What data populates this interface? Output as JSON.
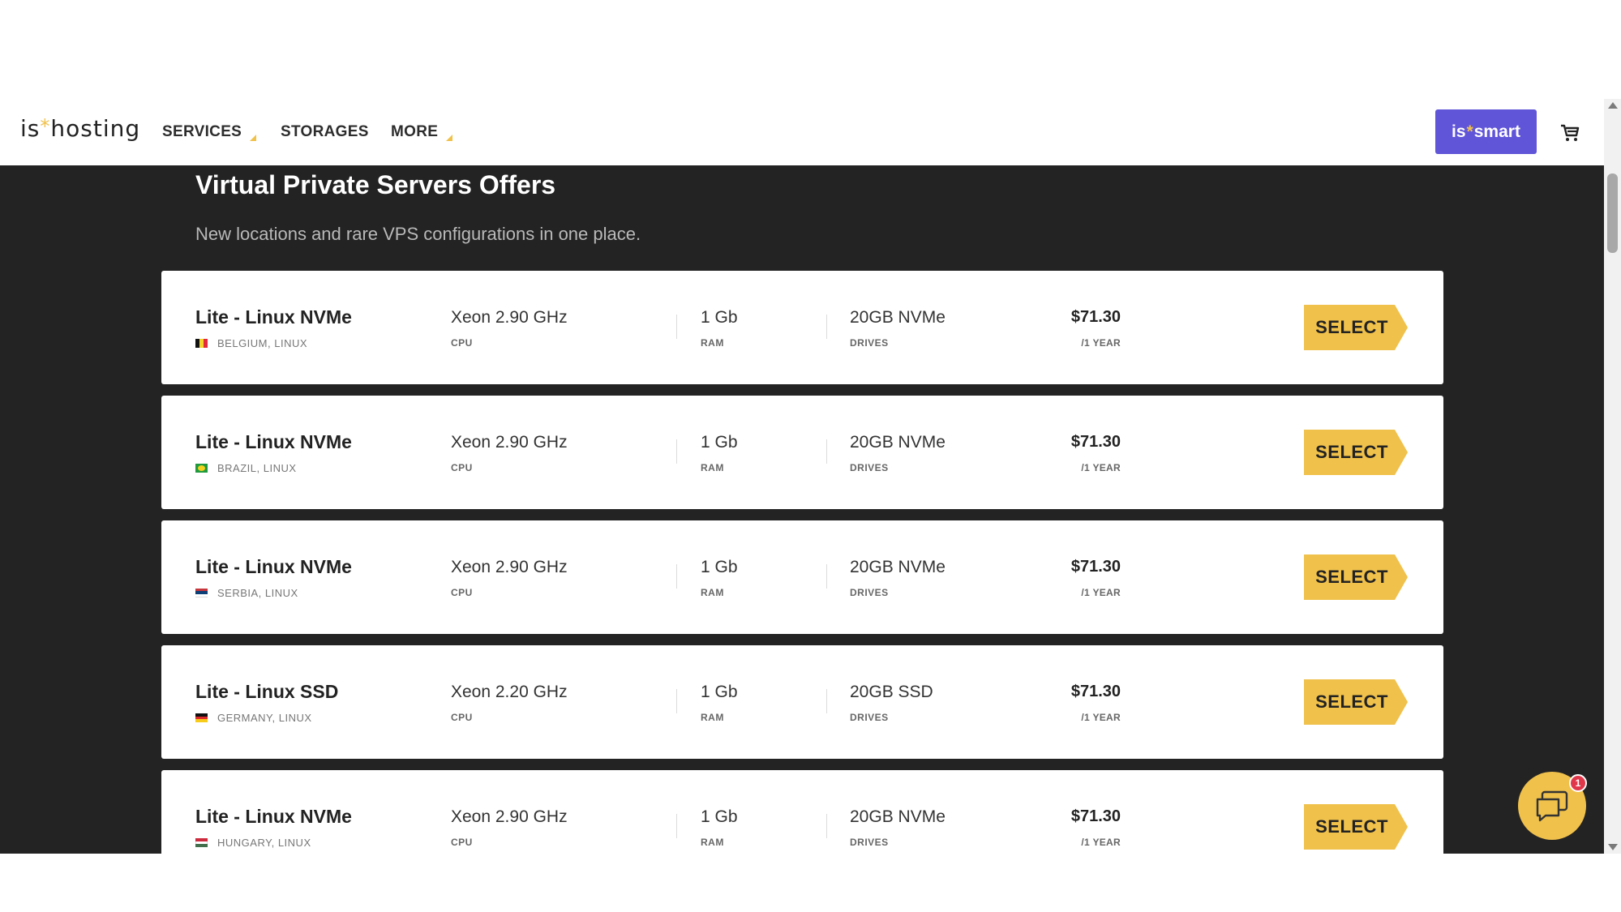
{
  "header": {
    "logo_prefix": "is",
    "logo_star": "*",
    "logo_suffix": "hosting",
    "nav": [
      {
        "label": "SERVICES",
        "dropdown": true
      },
      {
        "label": "STORAGES",
        "dropdown": false
      },
      {
        "label": "MORE",
        "dropdown": true
      }
    ],
    "smart_prefix": "is",
    "smart_star": "*",
    "smart_suffix": "smart",
    "cart_icon": "cart-icon"
  },
  "main": {
    "title": "Virtual Private Servers Offers",
    "subtitle": "New locations and rare VPS configurations in one place."
  },
  "offers": [
    {
      "name": "Lite - Linux NVMe",
      "location": "BELGIUM, LINUX",
      "flag": "belgium",
      "cpu": "Xeon 2.90 GHz",
      "cpu_label": "CPU",
      "ram": "1 Gb",
      "ram_label": "RAM",
      "drives": "20GB NVMe",
      "drives_label": "DRIVES",
      "price": "$71.30",
      "period": "/1 YEAR",
      "button": "SELECT"
    },
    {
      "name": "Lite - Linux NVMe",
      "location": "BRAZIL, LINUX",
      "flag": "brazil",
      "cpu": "Xeon 2.90 GHz",
      "cpu_label": "CPU",
      "ram": "1 Gb",
      "ram_label": "RAM",
      "drives": "20GB NVMe",
      "drives_label": "DRIVES",
      "price": "$71.30",
      "period": "/1 YEAR",
      "button": "SELECT"
    },
    {
      "name": "Lite - Linux NVMe",
      "location": "SERBIA, LINUX",
      "flag": "serbia",
      "cpu": "Xeon 2.90 GHz",
      "cpu_label": "CPU",
      "ram": "1 Gb",
      "ram_label": "RAM",
      "drives": "20GB NVMe",
      "drives_label": "DRIVES",
      "price": "$71.30",
      "period": "/1 YEAR",
      "button": "SELECT"
    },
    {
      "name": "Lite - Linux SSD",
      "location": "GERMANY, LINUX",
      "flag": "germany",
      "cpu": "Xeon 2.20 GHz",
      "cpu_label": "CPU",
      "ram": "1 Gb",
      "ram_label": "RAM",
      "drives": "20GB SSD",
      "drives_label": "DRIVES",
      "price": "$71.30",
      "period": "/1 YEAR",
      "button": "SELECT"
    },
    {
      "name": "Lite - Linux NVMe",
      "location": "HUNGARY, LINUX",
      "flag": "hungary",
      "cpu": "Xeon 2.90 GHz",
      "cpu_label": "CPU",
      "ram": "1 Gb",
      "ram_label": "RAM",
      "drives": "20GB NVMe",
      "drives_label": "DRIVES",
      "price": "$71.30",
      "period": "/1 YEAR",
      "button": "SELECT"
    }
  ],
  "chat": {
    "icon": "chat-icon",
    "badge_count": "1"
  },
  "colors": {
    "accent_yellow": "#f0c14b",
    "smart_purple": "#6055d8",
    "dark_bg": "#242323"
  }
}
